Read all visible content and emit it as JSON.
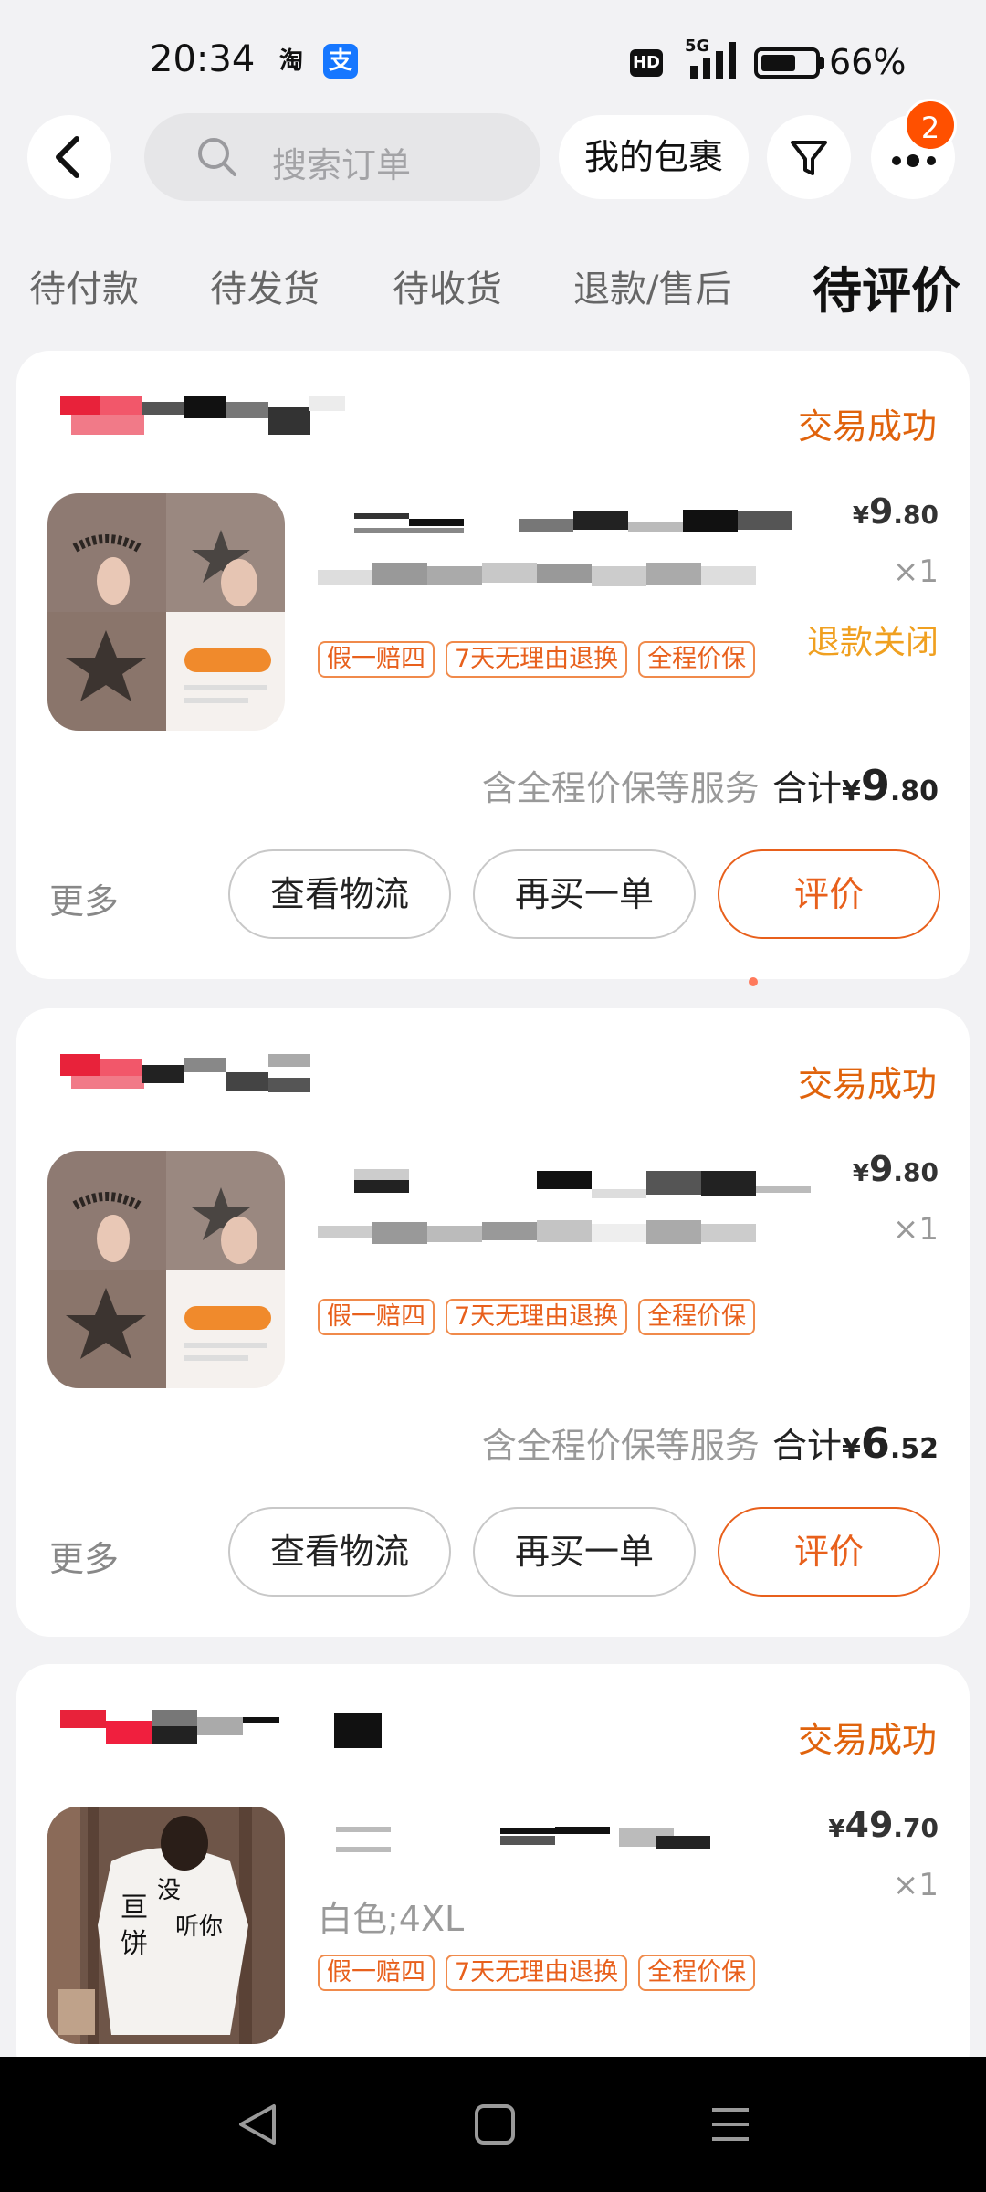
{
  "status_bar": {
    "time": "20:34",
    "app_icons": [
      "淘",
      "支"
    ],
    "hd": "HD",
    "network": "5G",
    "battery": "66%",
    "battery_level": 0.66
  },
  "header": {
    "search_placeholder": "搜索订单",
    "packages_button": "我的包裹",
    "notification_count": "2"
  },
  "tabs": [
    {
      "label": "待付款",
      "active": false
    },
    {
      "label": "待发货",
      "active": false
    },
    {
      "label": "待收货",
      "active": false
    },
    {
      "label": "退款/售后",
      "active": false
    },
    {
      "label": "待评价",
      "active": true
    }
  ],
  "orders": [
    {
      "status": "交易成功",
      "sku": "",
      "price_symbol": "¥",
      "price_int": "9",
      "price_dec": ".80",
      "qty": "×1",
      "refund_status": "退款关闭",
      "tags": [
        "假一赔四",
        "7天无理由退换",
        "全程价保"
      ],
      "service_note": "含全程价保等服务",
      "total_label": "合计",
      "total_symbol": "¥",
      "total_int": "9",
      "total_dec": ".80",
      "more": "更多",
      "logistics_button": "查看物流",
      "rebuy_button": "再买一单",
      "review_button": "评价"
    },
    {
      "status": "交易成功",
      "sku": "",
      "price_symbol": "¥",
      "price_int": "9",
      "price_dec": ".80",
      "qty": "×1",
      "refund_status": "",
      "tags": [
        "假一赔四",
        "7天无理由退换",
        "全程价保"
      ],
      "service_note": "含全程价保等服务",
      "total_label": "合计",
      "total_symbol": "¥",
      "total_int": "6",
      "total_dec": ".52",
      "more": "更多",
      "logistics_button": "查看物流",
      "rebuy_button": "再买一单",
      "review_button": "评价"
    },
    {
      "status": "交易成功",
      "sku": "白色;4XL",
      "price_symbol": "¥",
      "price_int": "49",
      "price_dec": ".70",
      "qty": "×1",
      "refund_status": "",
      "tags": [
        "假一赔四",
        "7天无理由退换",
        "全程价保"
      ]
    }
  ],
  "colors": {
    "accent": "#e8601c",
    "status_text": "#e0630c",
    "refund_text": "#f0a020",
    "badge": "#ff5000",
    "background": "#f2f2f4"
  }
}
